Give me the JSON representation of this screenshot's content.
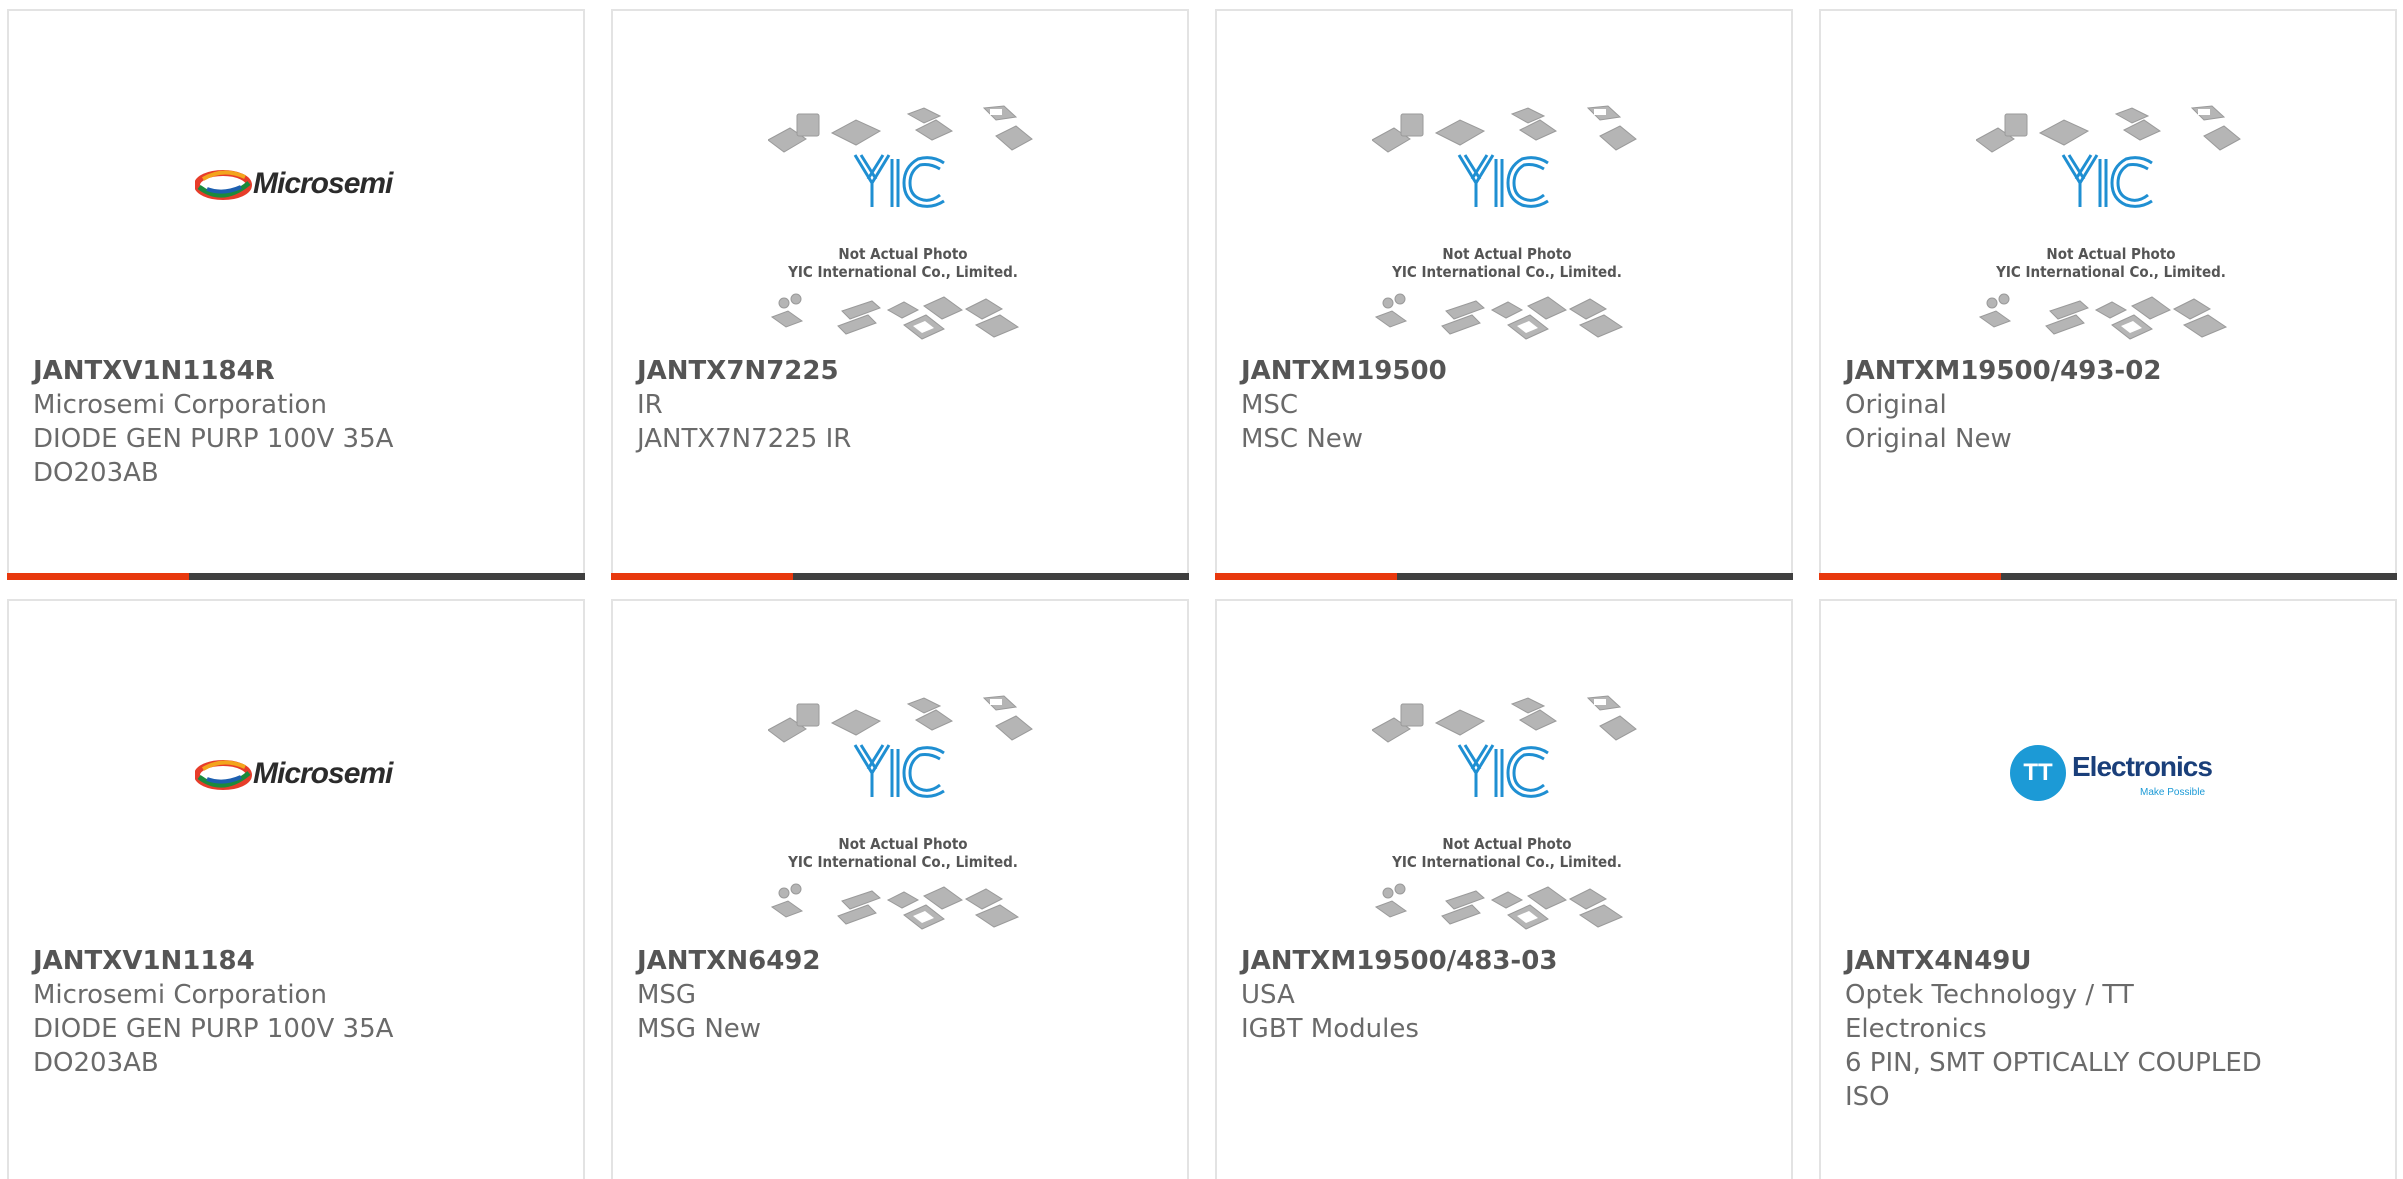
{
  "products": [
    {
      "part_no": "JANTXV1N1184R",
      "lines": [
        "Microsemi Corporation",
        "DIODE GEN PURP 100V 35A",
        "DO203AB"
      ],
      "image": "microsemi-logo",
      "logo_text": "Microsemi"
    },
    {
      "part_no": "JANTX7N7225",
      "lines": [
        "IR",
        "JANTX7N7225 IR"
      ],
      "image": "yic-placeholder"
    },
    {
      "part_no": "JANTXM19500",
      "lines": [
        "MSC",
        "MSC New"
      ],
      "image": "yic-placeholder"
    },
    {
      "part_no": "JANTXM19500/493-02",
      "lines": [
        "Original",
        "Original New"
      ],
      "image": "yic-placeholder"
    },
    {
      "part_no": "JANTXV1N1184",
      "lines": [
        "Microsemi Corporation",
        "DIODE GEN PURP 100V 35A",
        "DO203AB"
      ],
      "image": "microsemi-logo",
      "logo_text": "Microsemi"
    },
    {
      "part_no": "JANTXN6492",
      "lines": [
        "MSG",
        "MSG New"
      ],
      "image": "yic-placeholder"
    },
    {
      "part_no": "JANTXM19500/483-03",
      "lines": [
        "USA",
        "IGBT Modules"
      ],
      "image": "yic-placeholder"
    },
    {
      "part_no": "JANTX4N49U",
      "lines": [
        "Optek Technology / TT",
        "Electronics",
        "6 PIN, SMT OPTICALLY COUPLED",
        "ISO"
      ],
      "image": "tt-electronics-logo",
      "logo_text": "Electronics",
      "logo_tagline": "Make Possible",
      "logo_mark": "TT"
    }
  ],
  "placeholder": {
    "caption_line1": "Not Actual Photo",
    "caption_line2": "YIC International Co., Limited."
  },
  "colors": {
    "accent": "#e8380d",
    "bar": "#3f3f3f",
    "text": "#6a6a6a",
    "border": "#e3e3e3",
    "yic_blue": "#1f8fd2"
  }
}
